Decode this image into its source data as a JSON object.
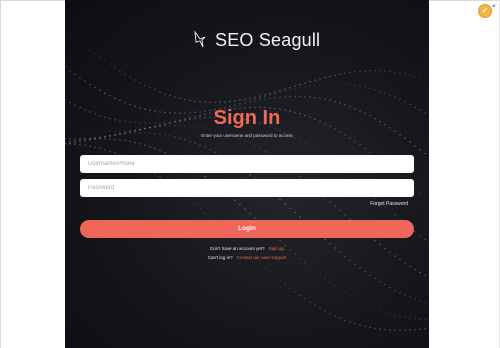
{
  "brand": {
    "name": "SEO Seagull",
    "icon": "bird-icon"
  },
  "login": {
    "title": "Sign In",
    "subtitle": "Enter your username and password to access",
    "username_placeholder": "Username/Phone",
    "password_placeholder": "Password",
    "forgot_label": "Forgot Password",
    "login_label": "Login",
    "signup_prompt": "Don't have an account yet?",
    "signup_link": "Sign up",
    "support_prompt": "Can't log in?",
    "support_link": "Contact our user support"
  },
  "colors": {
    "accent": "#f26a54",
    "button": "#f0665a",
    "panel": "#15161a"
  }
}
